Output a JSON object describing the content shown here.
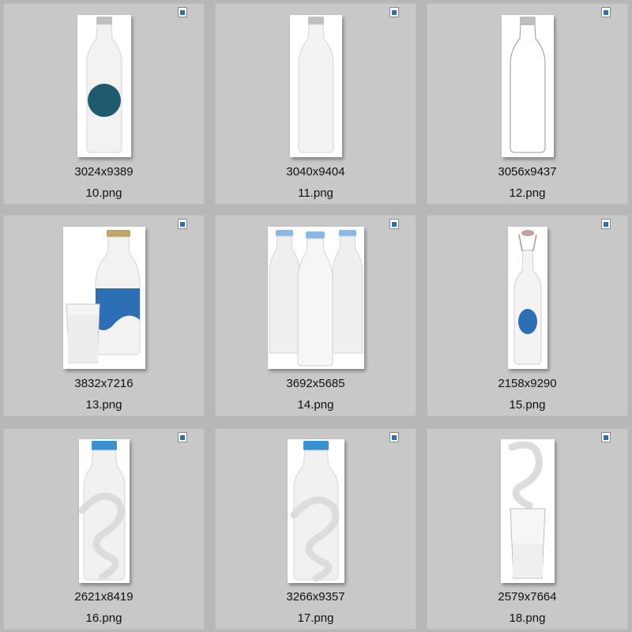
{
  "files": [
    {
      "dims": "3024x9389",
      "name": "10.png",
      "icon": "image-file-icon"
    },
    {
      "dims": "3040x9404",
      "name": "11.png",
      "icon": "image-file-icon"
    },
    {
      "dims": "3056x9437",
      "name": "12.png",
      "icon": "image-file-icon"
    },
    {
      "dims": "3832x7216",
      "name": "13.png",
      "icon": "image-file-icon"
    },
    {
      "dims": "3692x5685",
      "name": "14.png",
      "icon": "image-file-icon"
    },
    {
      "dims": "2158x9290",
      "name": "15.png",
      "icon": "image-file-icon"
    },
    {
      "dims": "2621x8419",
      "name": "16.png",
      "icon": "image-file-icon"
    },
    {
      "dims": "3266x9357",
      "name": "17.png",
      "icon": "image-file-icon"
    },
    {
      "dims": "2579x7664",
      "name": "18.png",
      "icon": "image-file-icon"
    }
  ],
  "colors": {
    "background": "#b7b7b7",
    "tile": "#c8c8c8",
    "label_dark_teal": "#1f5b6e",
    "label_blue": "#2d6fb5",
    "cap_blue": "#3a8fd0"
  }
}
